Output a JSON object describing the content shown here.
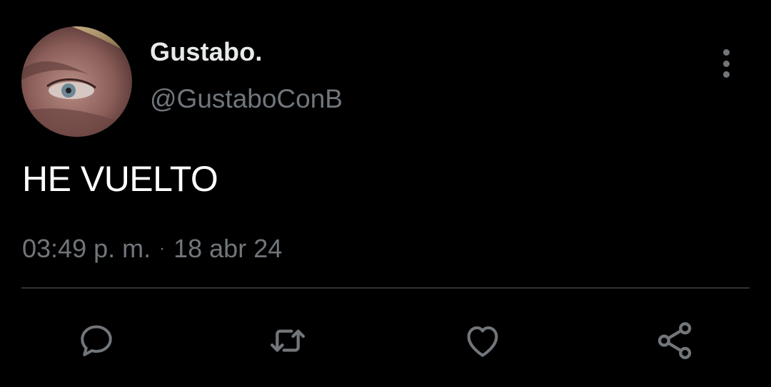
{
  "tweet": {
    "display_name": "Gustabo.",
    "handle": "@GustaboConB",
    "text": "HE VUELTO",
    "time": "03:49 p. m.",
    "separator": "·",
    "date": "18 abr 24"
  },
  "icons": {
    "more": "more-vertical-icon",
    "reply": "reply-icon",
    "retweet": "retweet-icon",
    "like": "heart-icon",
    "share": "share-icon"
  },
  "colors": {
    "background": "#000000",
    "primary_text": "#e7e9ea",
    "secondary_text": "#71767b",
    "divider": "#2f3336"
  }
}
